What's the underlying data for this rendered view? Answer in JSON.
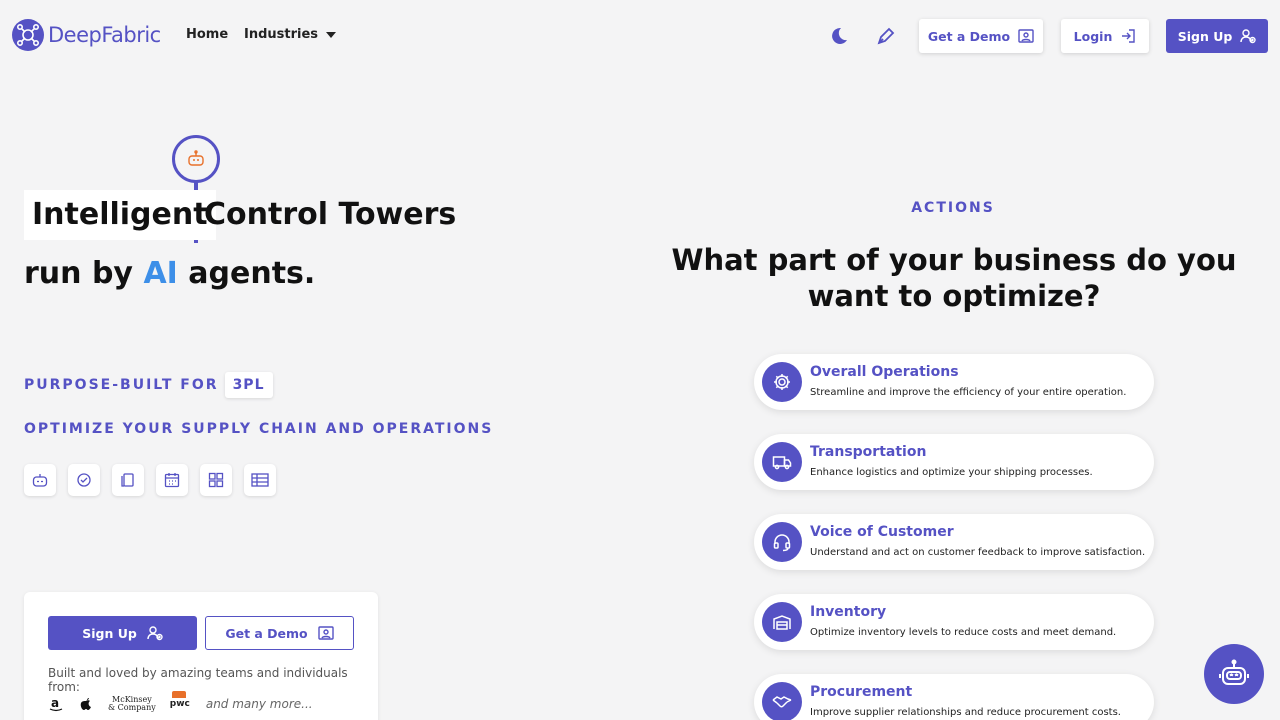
{
  "brand": {
    "name": "DeepFabric",
    "accent": "#5552c4",
    "ai_color": "#3d8fe8"
  },
  "nav": {
    "home": "Home",
    "industries": "Industries",
    "theme_icon": "moon-icon",
    "feedback_icon": "pen-icon",
    "demo": "Get a Demo",
    "login": "Login",
    "signup": "Sign Up"
  },
  "hero": {
    "word_highlight": "Intelligent",
    "word_rest": "Control Towers",
    "line2_pre": "run by",
    "line2_ai": "AI",
    "line2_post": "agents.",
    "purpose_label": "PURPOSE-BUILT FOR",
    "purpose_tag": "3PL",
    "optimize": "OPTIMIZE YOUR SUPPLY CHAIN AND OPERATIONS",
    "tools": [
      "robot-icon",
      "check-circle-icon",
      "copy-icon",
      "calendar-icon",
      "dashboard-icon",
      "table-icon"
    ]
  },
  "cta": {
    "signup": "Sign Up",
    "demo": "Get a Demo",
    "loved": "Built and loved by amazing teams and individuals from:",
    "logos": [
      "amazon-logo",
      "apple-logo",
      "McKinsey & Company",
      "pwc"
    ],
    "mckinsey_line1": "McKinsey",
    "mckinsey_line2": "& Company",
    "pwc": "pwc",
    "many": "and many more..."
  },
  "right": {
    "label": "ACTIONS",
    "question": "What part of your business do you want to optimize?",
    "cards": [
      {
        "title": "Overall Operations",
        "desc": "Streamline and improve the efficiency of your entire operation.",
        "icon": "gear-icon"
      },
      {
        "title": "Transportation",
        "desc": "Enhance logistics and optimize your shipping processes.",
        "icon": "truck-icon"
      },
      {
        "title": "Voice of Customer",
        "desc": "Understand and act on customer feedback to improve satisfaction.",
        "icon": "headset-icon"
      },
      {
        "title": "Inventory",
        "desc": "Optimize inventory levels to reduce costs and meet demand.",
        "icon": "warehouse-icon"
      },
      {
        "title": "Procurement",
        "desc": "Improve supplier relationships and reduce procurement costs.",
        "icon": "handshake-icon"
      }
    ]
  }
}
